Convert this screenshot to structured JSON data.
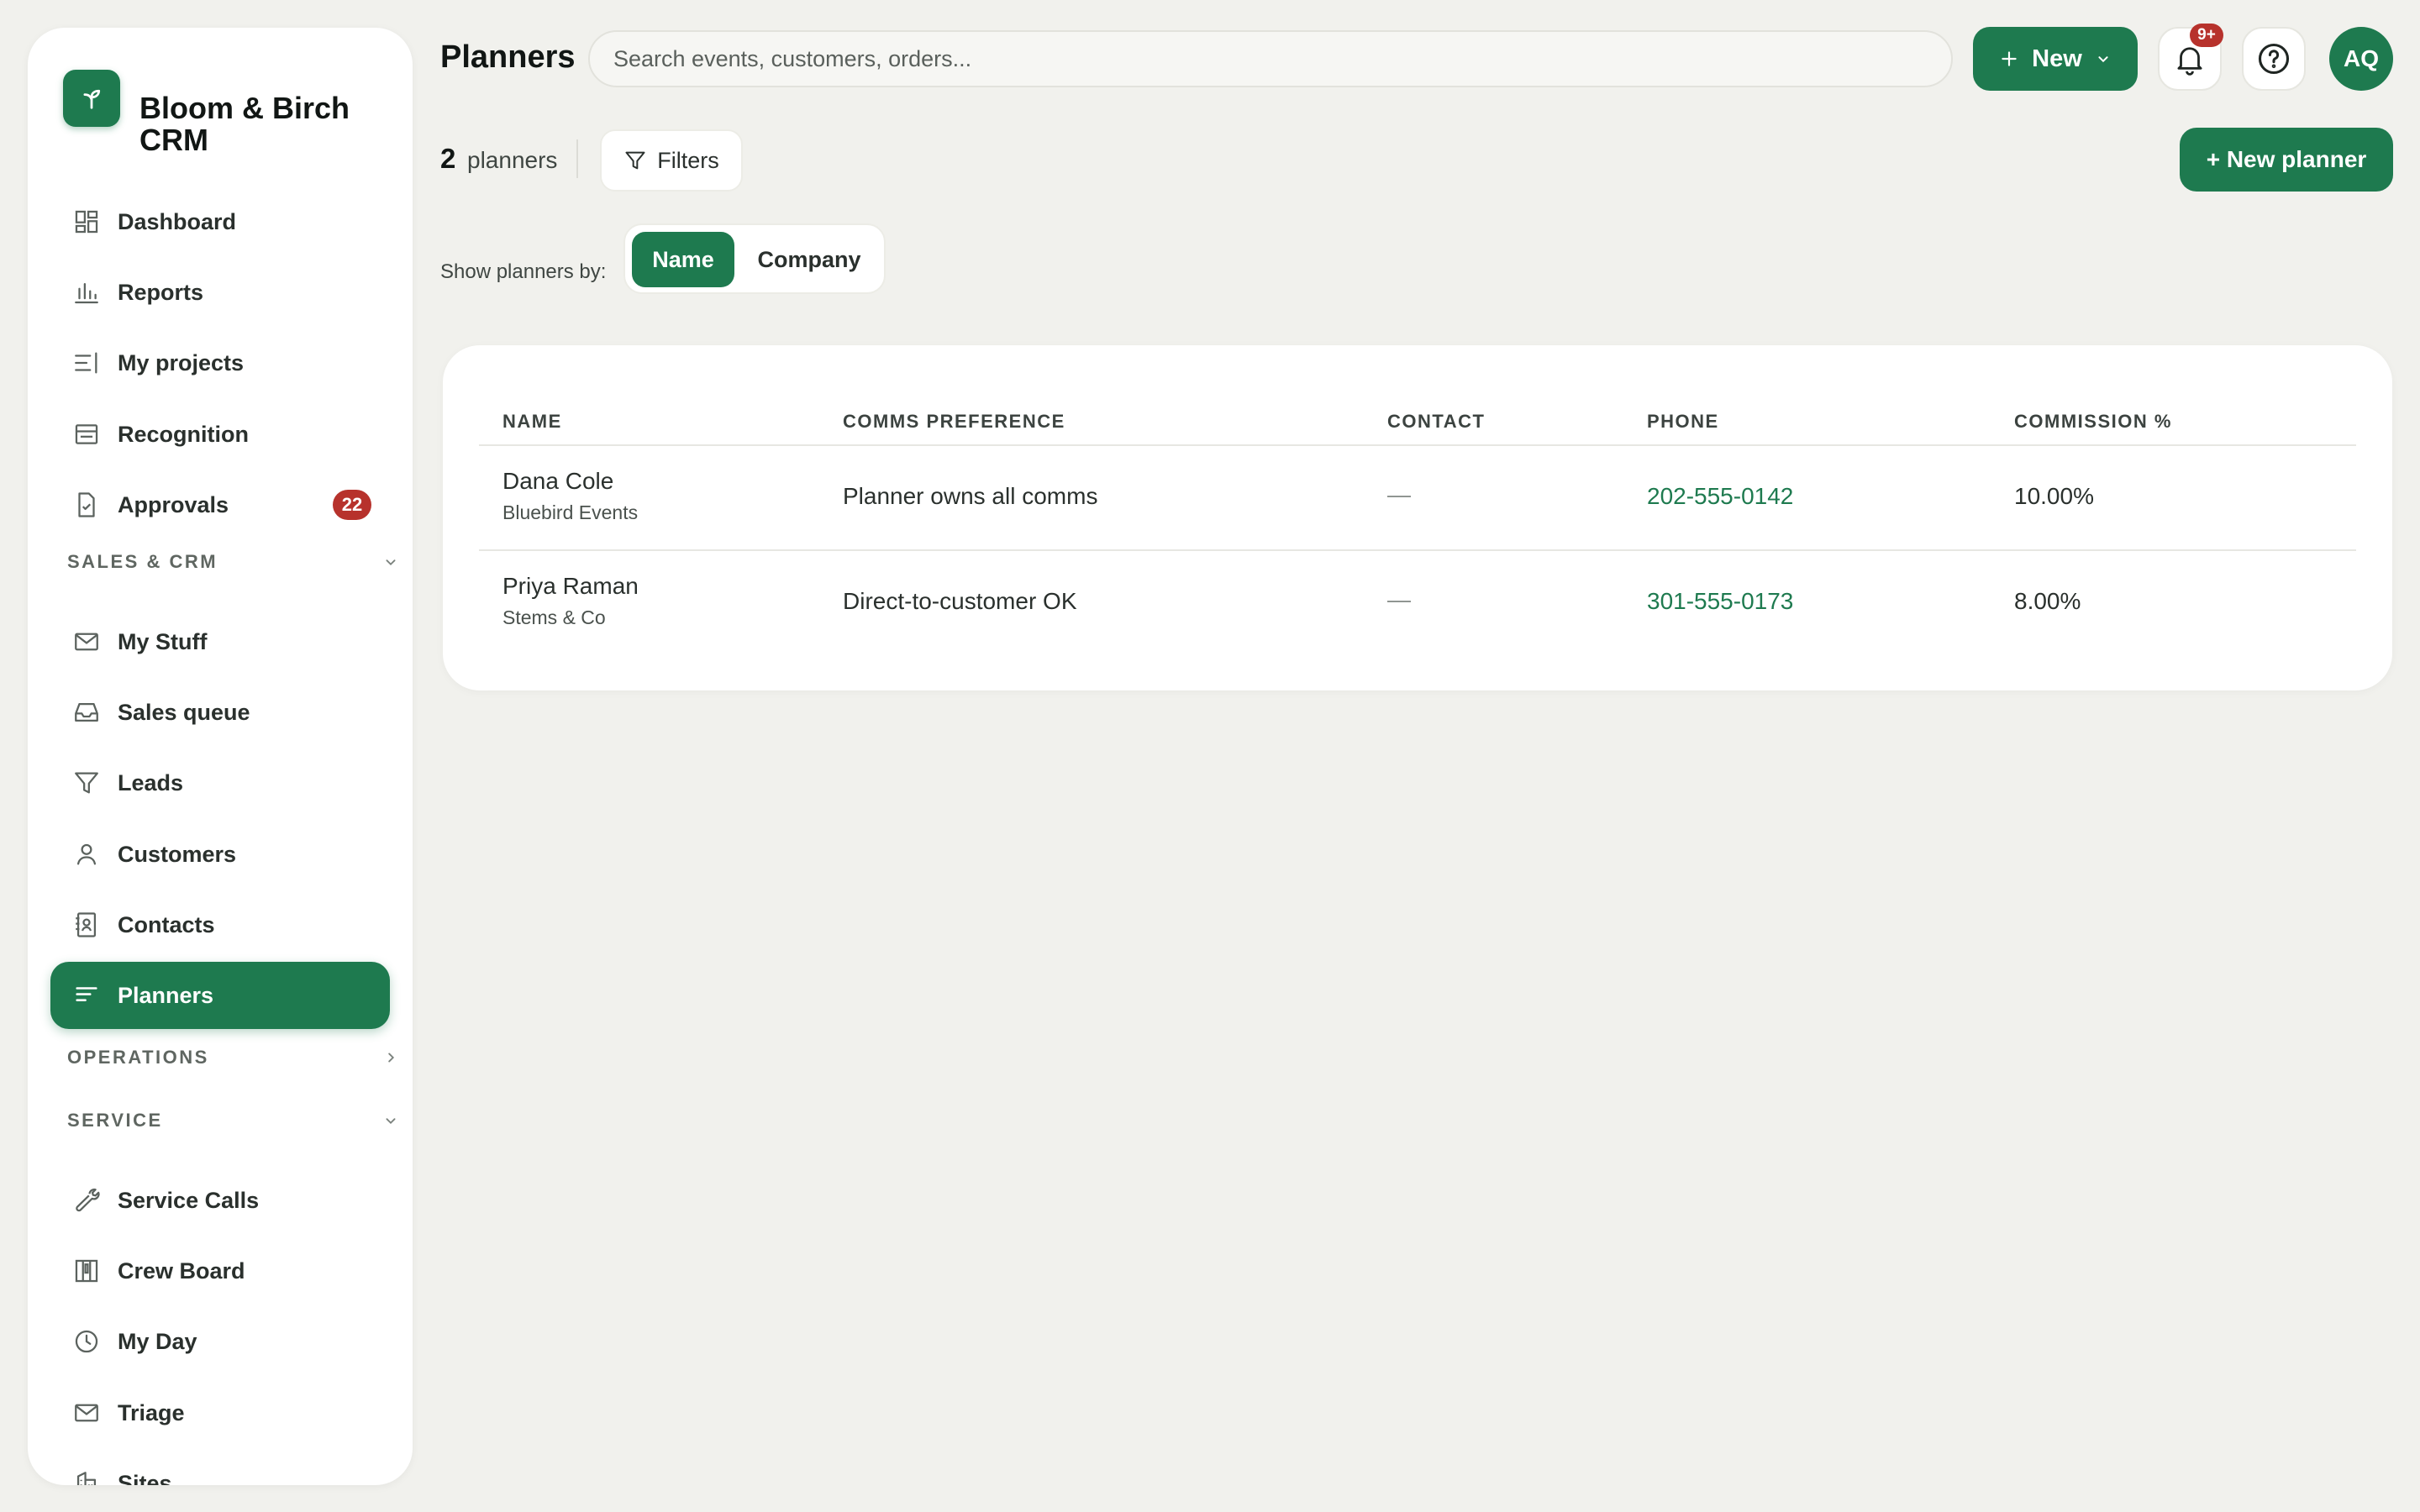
{
  "app": {
    "name": "Bloom & Birch CRM"
  },
  "sidebar": {
    "top_items": [
      {
        "label": "Dashboard",
        "icon": "dashboard-icon"
      },
      {
        "label": "Reports",
        "icon": "bar-chart-icon"
      },
      {
        "label": "My projects",
        "icon": "list-icon"
      },
      {
        "label": "Recognition",
        "icon": "card-icon"
      },
      {
        "label": "Approvals",
        "icon": "file-check-icon",
        "badge": "22"
      }
    ],
    "sections": [
      {
        "label": "SALES & CRM",
        "expanded": true
      },
      {
        "label": "OPERATIONS",
        "expanded": false
      },
      {
        "label": "SERVICE",
        "expanded": true
      }
    ],
    "sales_items": [
      {
        "label": "My Stuff",
        "icon": "mail-icon"
      },
      {
        "label": "Sales queue",
        "icon": "inbox-icon"
      },
      {
        "label": "Leads",
        "icon": "filter-icon"
      },
      {
        "label": "Customers",
        "icon": "user-icon"
      },
      {
        "label": "Contacts",
        "icon": "contact-book-icon"
      },
      {
        "label": "Planners",
        "icon": "planner-lines-icon",
        "active": true
      }
    ],
    "service_items": [
      {
        "label": "Service Calls",
        "icon": "wrench-icon"
      },
      {
        "label": "Crew Board",
        "icon": "kanban-icon"
      },
      {
        "label": "My Day",
        "icon": "clock-icon"
      },
      {
        "label": "Triage",
        "icon": "mail-icon"
      },
      {
        "label": "Sites",
        "icon": "building-icon"
      }
    ]
  },
  "header": {
    "title": "Planners",
    "search_placeholder": "Search events, customers, orders...",
    "new_label": "New",
    "notifications_count": "9+",
    "avatar_initials": "AQ"
  },
  "toolbar": {
    "count": "2",
    "count_label": "planners",
    "filters_label": "Filters",
    "new_planner_label": "+ New planner",
    "show_by_label": "Show planners by:",
    "show_by_options": [
      "Name",
      "Company"
    ],
    "show_by_selected": "Name"
  },
  "table": {
    "columns": [
      "NAME",
      "COMMS PREFERENCE",
      "CONTACT",
      "PHONE",
      "COMMISSION %"
    ],
    "rows": [
      {
        "name": "Dana Cole",
        "company": "Bluebird Events",
        "comms": "Planner owns all comms",
        "contact": "—",
        "phone": "202-555-0142",
        "commission": "10.00%"
      },
      {
        "name": "Priya Raman",
        "company": "Stems & Co",
        "comms": "Direct-to-customer OK",
        "contact": "—",
        "phone": "301-555-0173",
        "commission": "8.00%"
      }
    ]
  },
  "colors": {
    "brand": "#1e7a4f",
    "badge": "#b7322c",
    "background": "#f1f1ed"
  }
}
